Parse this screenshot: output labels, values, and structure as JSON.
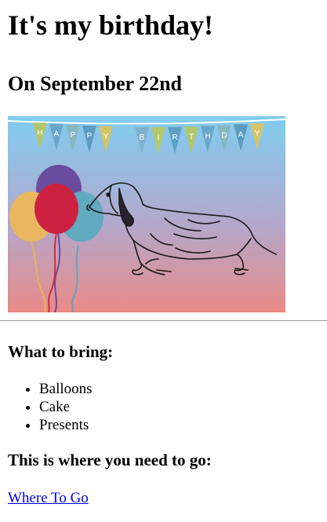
{
  "heading": "It's my birthday!",
  "date_heading": "On September 22nd",
  "banner": {
    "letters": [
      "H",
      "A",
      "P",
      "P",
      "Y",
      "B",
      "I",
      "R",
      "T",
      "H",
      "D",
      "A",
      "Y"
    ],
    "colors": [
      "#b2c66b",
      "#6aa6c9",
      "#88b7c0",
      "#5d9bbf",
      "#d6c46b",
      "#7fb2cf",
      "#b4c86d",
      "#5e9fc4"
    ]
  },
  "what_to_bring_heading": "What to bring:",
  "bring_items": [
    "Balloons",
    "Cake",
    "Presents"
  ],
  "where_heading": "This is where you need to go:",
  "where_link": "Where To Go",
  "colors": {
    "link": "#0000ee",
    "sky_top": "#80cdf0",
    "sky_bottom": "#ea8a86"
  }
}
